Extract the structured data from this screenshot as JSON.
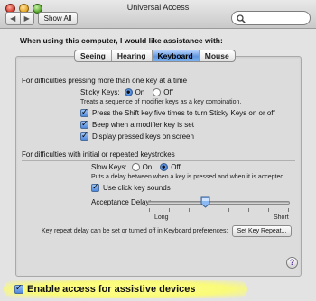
{
  "window": {
    "title": "Universal Access"
  },
  "toolbar": {
    "show_all": "Show All",
    "nav_back": "◀",
    "nav_forward": "▶"
  },
  "heading": "When using this computer, I would like assistance with:",
  "tabs": [
    {
      "label": "Seeing",
      "active": false
    },
    {
      "label": "Hearing",
      "active": false
    },
    {
      "label": "Keyboard",
      "active": true
    },
    {
      "label": "Mouse",
      "active": false
    }
  ],
  "sticky_section": {
    "title": "For difficulties pressing more than one key at a time",
    "sticky_label": "Sticky Keys:",
    "on_label": "On",
    "off_label": "Off",
    "selected": "On",
    "description": "Treats a sequence of modifier keys as a key combination.",
    "options": [
      "Press the Shift key five times to turn Sticky Keys on or off",
      "Beep when a modifier key is set",
      "Display pressed keys on screen"
    ]
  },
  "slow_section": {
    "title": "For difficulties with initial or repeated keystrokes",
    "slow_label": "Slow Keys:",
    "on_label": "On",
    "off_label": "Off",
    "selected": "Off",
    "description": "Puts a delay between when a key is pressed and when it is accepted.",
    "click_sounds": "Use click key sounds",
    "delay_label": "Acceptance Delay:",
    "delay_value_fraction": 0.4,
    "long_label": "Long",
    "short_label": "Short"
  },
  "repeat": {
    "text": "Key repeat delay can be set or turned off in Keyboard preferences:",
    "button": "Set Key Repeat..."
  },
  "help": "?",
  "bottom": {
    "assistive": "Enable access for assistive devices"
  },
  "colors": {
    "accent": "#4f89dc",
    "highlight": "#fafa7a"
  }
}
